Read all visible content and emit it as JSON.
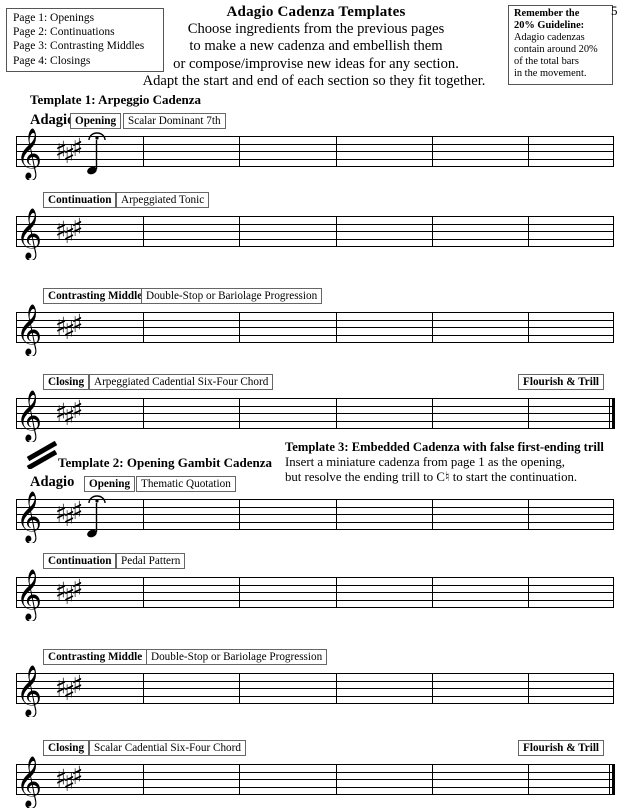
{
  "page": {
    "number": "5",
    "title": "Adagio Cadenza Templates",
    "subtitle_lines": [
      "Choose ingredients from the previous pages",
      "to make a new cadenza and embellish them",
      "or compose/improvise new ideas for any section.",
      "Adapt the start and end of each section so they fit together."
    ]
  },
  "pages_index": {
    "items": [
      "Page 1: Openings",
      "Page 2: Continuations",
      "Page 3: Contrasting Middles",
      "Page 4: Closings"
    ]
  },
  "guideline": {
    "heading_line1": "Remember the",
    "heading_line2": "20% Guideline:",
    "body_lines": [
      "Adagio cadenzas",
      "contain around 20%",
      "of the total bars",
      "in the movement."
    ]
  },
  "template1": {
    "heading": "Template 1: Arpeggio Cadenza",
    "tempo": "Adagio",
    "systems": [
      {
        "section_label": "Opening",
        "ingredient_label": "Scalar Dominant 7th",
        "right_label": "",
        "clef": "treble-clef",
        "key_signature": "3-sharps",
        "has_pickup_note": true,
        "has_fermata": true,
        "barlines": 5,
        "end_barline": "single"
      },
      {
        "section_label": "Continuation",
        "ingredient_label": "Arpeggiated Tonic",
        "right_label": "",
        "clef": "treble-clef",
        "key_signature": "3-sharps",
        "has_pickup_note": false,
        "has_fermata": false,
        "barlines": 5,
        "end_barline": "single"
      },
      {
        "section_label": "Contrasting Middle",
        "ingredient_label": "Double-Stop or Bariolage Progression",
        "right_label": "",
        "clef": "treble-clef",
        "key_signature": "3-sharps",
        "has_pickup_note": false,
        "has_fermata": false,
        "barlines": 5,
        "end_barline": "single"
      },
      {
        "section_label": "Closing",
        "ingredient_label": "Arpeggiated Cadential Six-Four Chord",
        "right_label": "Flourish & Trill",
        "clef": "treble-clef",
        "key_signature": "3-sharps",
        "has_pickup_note": false,
        "has_fermata": false,
        "barlines": 5,
        "end_barline": "final"
      }
    ]
  },
  "template2": {
    "heading": "Template 2: Opening Gambit Cadenza",
    "tempo": "Adagio",
    "systems": [
      {
        "section_label": "Opening",
        "ingredient_label": "Thematic Quotation",
        "right_label": "",
        "clef": "treble-clef",
        "key_signature": "3-sharps",
        "has_pickup_note": true,
        "has_fermata": true,
        "barlines": 5,
        "end_barline": "single"
      },
      {
        "section_label": "Continuation",
        "ingredient_label": "Pedal Pattern",
        "right_label": "",
        "clef": "treble-clef",
        "key_signature": "3-sharps",
        "has_pickup_note": false,
        "has_fermata": false,
        "barlines": 5,
        "end_barline": "single"
      },
      {
        "section_label": "Contrasting Middle",
        "ingredient_label": "Double-Stop or Bariolage Progression",
        "right_label": "",
        "clef": "treble-clef",
        "key_signature": "3-sharps",
        "has_pickup_note": false,
        "has_fermata": false,
        "barlines": 5,
        "end_barline": "single"
      },
      {
        "section_label": "Closing",
        "ingredient_label": "Scalar Cadential Six-Four Chord",
        "right_label": "Flourish & Trill",
        "clef": "treble-clef",
        "key_signature": "3-sharps",
        "has_pickup_note": false,
        "has_fermata": false,
        "barlines": 5,
        "end_barline": "final"
      }
    ]
  },
  "template3": {
    "heading": "Template 3: Embedded Cadenza with false first-ending trill",
    "lines": [
      "Insert a miniature cadenza from page 1 as the opening,",
      "but resolve the ending trill to C♮ to start the continuation."
    ]
  },
  "colors": {
    "ink": "#000000",
    "box_border": "#666666",
    "staff_line": "#000000",
    "paper": "#ffffff"
  }
}
